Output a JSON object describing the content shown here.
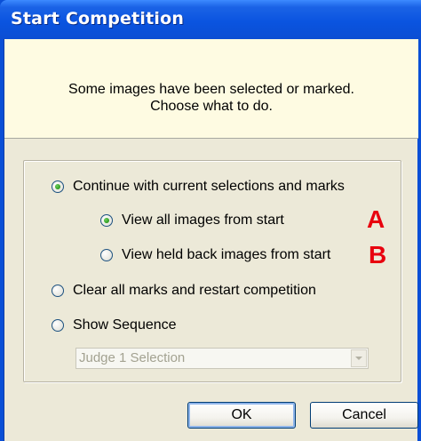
{
  "dialog": {
    "title": "Start Competition",
    "message_line1": "Some images have been selected or marked.",
    "message_line2": "Choose what to do."
  },
  "options": {
    "continue": {
      "label": "Continue with current selections and marks",
      "checked": true
    },
    "view_all": {
      "label": "View all images from start",
      "checked": true,
      "annotation": "A"
    },
    "view_held": {
      "label": "View held back images from start",
      "checked": false,
      "annotation": "B"
    },
    "clear_all": {
      "label": "Clear all marks and restart competition",
      "checked": false
    },
    "show_sequence": {
      "label": "Show Sequence",
      "checked": false
    }
  },
  "sequence_select": {
    "value": "Judge 1 Selection",
    "disabled": true
  },
  "buttons": {
    "ok": "OK",
    "cancel": "Cancel"
  },
  "colors": {
    "title_bar": "#0a54e0",
    "dialog_bg": "#ece9d8",
    "info_bg": "#fefbe2",
    "annotation_red": "#e8000e"
  }
}
